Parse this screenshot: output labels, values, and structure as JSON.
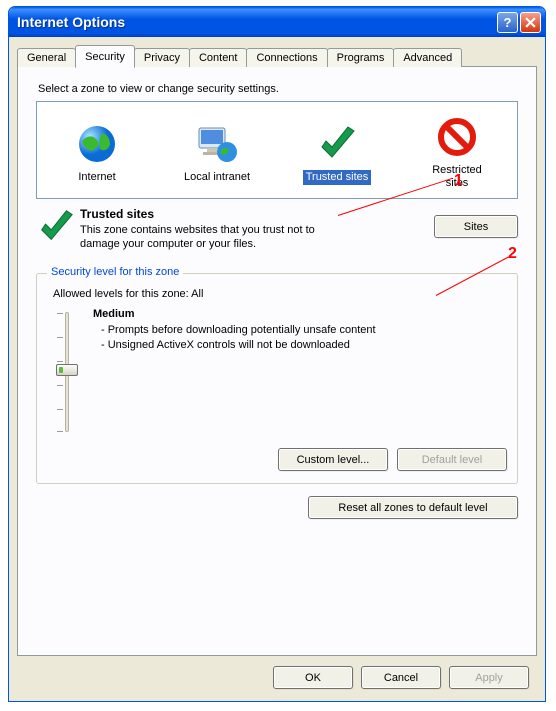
{
  "window": {
    "title": "Internet Options"
  },
  "tabs": {
    "general": "General",
    "security": "Security",
    "privacy": "Privacy",
    "content": "Content",
    "connections": "Connections",
    "programs": "Programs",
    "advanced": "Advanced"
  },
  "security": {
    "prompt": "Select a zone to view or change security settings.",
    "zones": {
      "internet": "Internet",
      "local_intranet": "Local intranet",
      "trusted_sites": "Trusted sites",
      "restricted_sites": "Restricted\nsites"
    },
    "selected_zone_title": "Trusted sites",
    "selected_zone_desc": "This zone contains websites that you trust not to damage your computer or your files.",
    "sites_button": "Sites",
    "group_title": "Security level for this zone",
    "allowed_levels": "Allowed levels for this zone: All",
    "level_name": "Medium",
    "level_bullet1": "- Prompts before downloading potentially unsafe content",
    "level_bullet2": "- Unsigned ActiveX controls will not be downloaded",
    "custom_level_button": "Custom level...",
    "default_level_button": "Default level",
    "reset_button": "Reset all zones to default level"
  },
  "dialog_buttons": {
    "ok": "OK",
    "cancel": "Cancel",
    "apply": "Apply"
  },
  "annotations": {
    "one": "1",
    "two": "2"
  }
}
